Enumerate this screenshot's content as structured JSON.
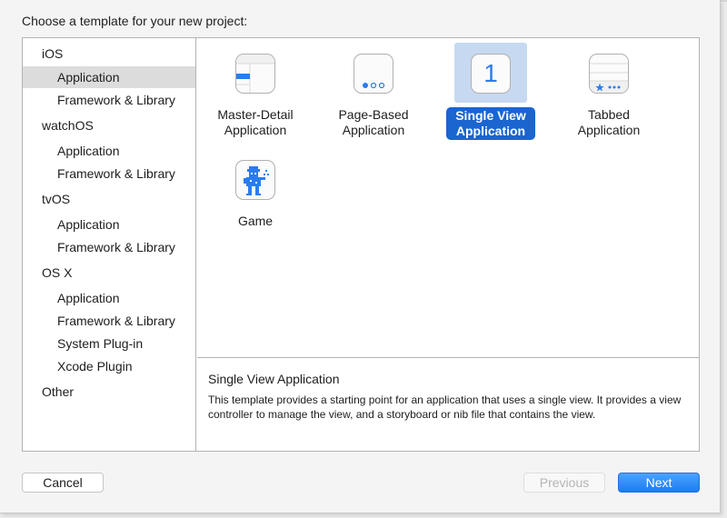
{
  "dialog": {
    "prompt": "Choose a template for your new project:"
  },
  "sidebar": {
    "items": [
      {
        "label": "iOS",
        "type": "group"
      },
      {
        "label": "Application",
        "type": "child",
        "selected": true
      },
      {
        "label": "Framework & Library",
        "type": "child"
      },
      {
        "label": "watchOS",
        "type": "group"
      },
      {
        "label": "Application",
        "type": "child"
      },
      {
        "label": "Framework & Library",
        "type": "child"
      },
      {
        "label": "tvOS",
        "type": "group"
      },
      {
        "label": "Application",
        "type": "child"
      },
      {
        "label": "Framework & Library",
        "type": "child"
      },
      {
        "label": "OS X",
        "type": "group"
      },
      {
        "label": "Application",
        "type": "child"
      },
      {
        "label": "Framework & Library",
        "type": "child"
      },
      {
        "label": "System Plug-in",
        "type": "child"
      },
      {
        "label": "Xcode Plugin",
        "type": "child"
      },
      {
        "label": "Other",
        "type": "group"
      }
    ]
  },
  "templates": [
    {
      "line1": "Master-Detail",
      "line2": "Application",
      "icon": "master-detail-icon"
    },
    {
      "line1": "Page-Based",
      "line2": "Application",
      "icon": "page-based-icon"
    },
    {
      "line1": "Single View",
      "line2": "Application",
      "icon": "single-view-icon",
      "icon_text": "1",
      "selected": true
    },
    {
      "line1": "Tabbed",
      "line2": "Application",
      "icon": "tabbed-icon"
    },
    {
      "line1": "Game",
      "line2": "",
      "icon": "game-icon"
    }
  ],
  "description": {
    "title": "Single View Application",
    "body": "This template provides a starting point for an application that uses a single view. It provides a view controller to manage the view, and a storyboard or nib file that contains the view."
  },
  "buttons": {
    "cancel": "Cancel",
    "previous": "Previous",
    "next": "Next"
  },
  "colors": {
    "accent": "#1a65cf",
    "selection_bg": "#c6d9f1",
    "icon_blue": "#2a7cf0"
  }
}
